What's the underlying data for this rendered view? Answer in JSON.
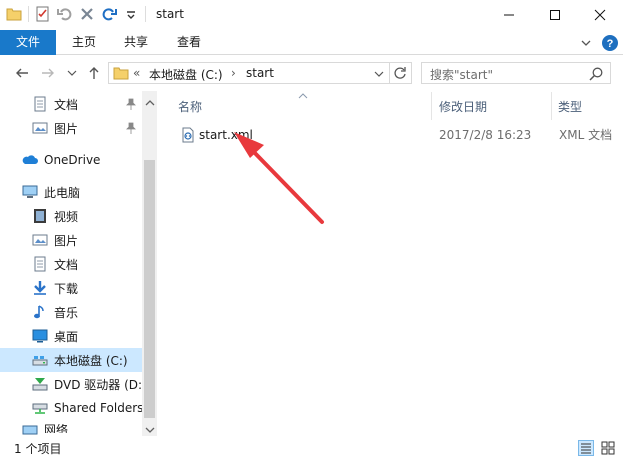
{
  "window": {
    "title": "start"
  },
  "ribbon": {
    "tabs": [
      "文件",
      "主页",
      "共享",
      "查看"
    ]
  },
  "address": {
    "overflow": "«",
    "segments": [
      "本地磁盘 (C:)",
      "start"
    ],
    "separator": "›"
  },
  "search": {
    "placeholder": "搜索\"start\""
  },
  "sidebar": {
    "quick_access": [
      {
        "label": "文档",
        "icon": "document-icon",
        "pinned": true
      },
      {
        "label": "图片",
        "icon": "pictures-icon",
        "pinned": true
      }
    ],
    "onedrive": {
      "label": "OneDrive",
      "icon": "onedrive-cloud-icon"
    },
    "this_pc": {
      "label": "此电脑",
      "icon": "computer-icon"
    },
    "pc_items": [
      {
        "label": "视频",
        "icon": "video-icon"
      },
      {
        "label": "图片",
        "icon": "pictures-icon"
      },
      {
        "label": "文档",
        "icon": "document-icon"
      },
      {
        "label": "下载",
        "icon": "download-icon"
      },
      {
        "label": "音乐",
        "icon": "music-icon"
      },
      {
        "label": "桌面",
        "icon": "desktop-icon"
      },
      {
        "label": "本地磁盘 (C:)",
        "icon": "drive-icon",
        "selected": true
      },
      {
        "label": "DVD 驱动器 (D:",
        "icon": "dvd-drive-icon"
      },
      {
        "label": "Shared Folders",
        "icon": "network-drive-icon"
      }
    ],
    "network_partial": "网络"
  },
  "columns": {
    "name": "名称",
    "modified": "修改日期",
    "type": "类型"
  },
  "files": [
    {
      "name": "start.xml",
      "modified": "2017/2/8 16:23",
      "type": "XML 文档",
      "icon": "xml-file-icon"
    }
  ],
  "status": {
    "item_count": "1 个项目"
  },
  "annotation": {
    "color": "#e8393d"
  }
}
